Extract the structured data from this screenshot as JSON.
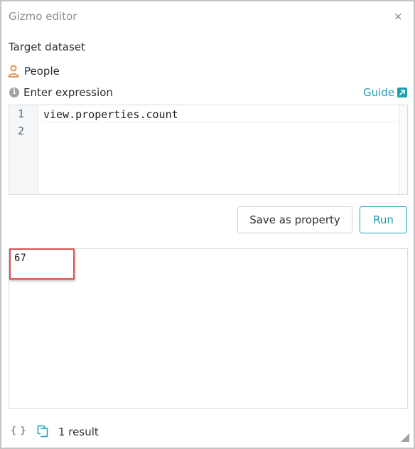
{
  "window": {
    "title": "Gizmo editor",
    "close_glyph": "×"
  },
  "target": {
    "label": "Target dataset",
    "dataset_name": "People",
    "dataset_icon": "person-icon"
  },
  "expression": {
    "info_glyph": "i",
    "label": "Enter expression",
    "guide_label": "Guide",
    "guide_icon": "external-link-icon"
  },
  "editor": {
    "line_numbers": [
      "1",
      "2"
    ],
    "lines": [
      "view.properties.count",
      ""
    ]
  },
  "buttons": {
    "save_label": "Save as property",
    "run_label": "Run"
  },
  "results": {
    "value": "67"
  },
  "footer": {
    "braces_glyph": "{ }",
    "copy_icon": "copy-icon",
    "count_label": "1 result"
  },
  "colors": {
    "accent": "#1ea0b4",
    "person_icon": "#e07b2a",
    "highlight": "#d9534f"
  }
}
